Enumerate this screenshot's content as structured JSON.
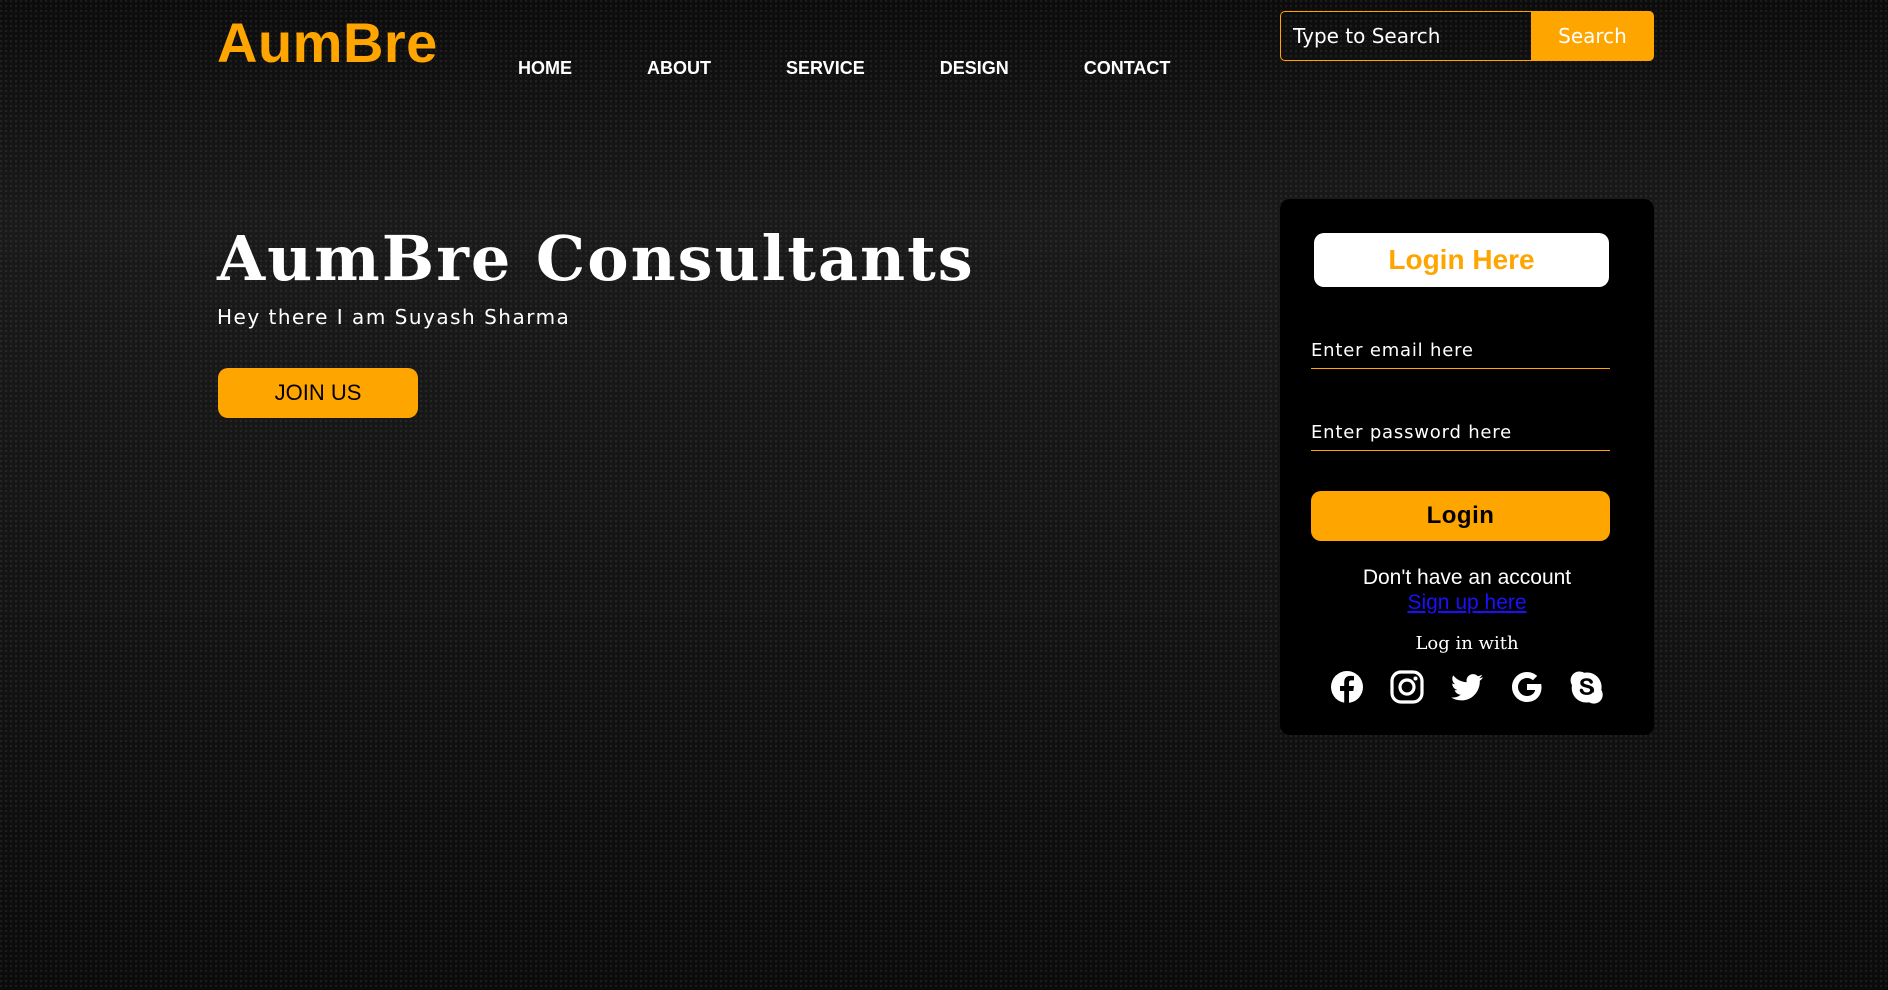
{
  "brand": {
    "logo": "AumBre",
    "accent_color": "#ffa500"
  },
  "nav": {
    "items": [
      "HOME",
      "ABOUT",
      "SERVICE",
      "DESIGN",
      "CONTACT"
    ]
  },
  "search": {
    "placeholder": "Type to Search",
    "button_label": "Search"
  },
  "hero": {
    "title": "AumBre Consultants",
    "subtitle": "Hey there I am Suyash Sharma",
    "cta_label": "JOIN US"
  },
  "login": {
    "heading": "Login Here",
    "email_placeholder": "Enter email here",
    "password_placeholder": "Enter password here",
    "button_label": "Login",
    "no_account_text": "Don't have an account",
    "signup_link_text": "Sign up here",
    "login_with_text": "Log in with",
    "social_icons": [
      "facebook-icon",
      "instagram-icon",
      "twitter-icon",
      "google-icon",
      "skype-icon"
    ]
  }
}
